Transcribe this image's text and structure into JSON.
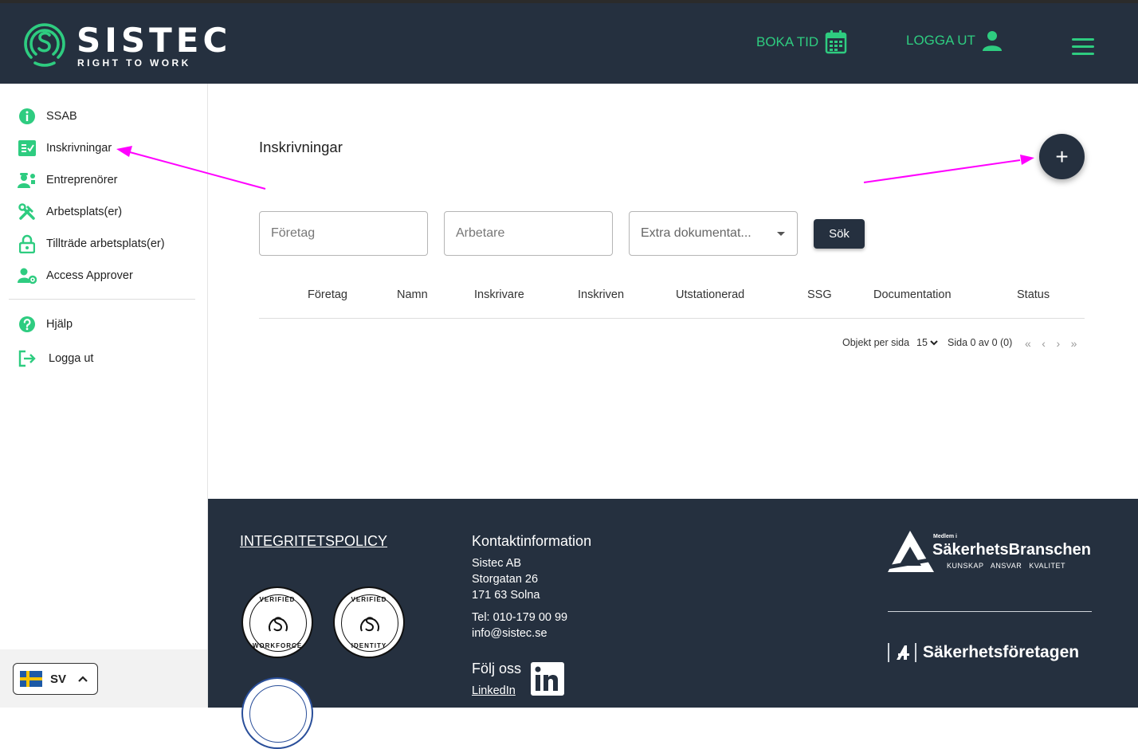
{
  "brand": {
    "name": "SISTEC",
    "tagline": "RIGHT TO WORK",
    "accent": "#2ecc80",
    "dark": "#25303f"
  },
  "header": {
    "book_label": "BOKA TID",
    "logout_label": "LOGGA UT",
    "icons": {
      "book": "calendar-icon",
      "logout": "user-icon",
      "menu": "hamburger-menu-icon"
    }
  },
  "sidebar": {
    "items": [
      {
        "label": "SSAB",
        "icon": "info-icon"
      },
      {
        "label": "Inskrivningar",
        "icon": "checklist-icon"
      },
      {
        "label": "Entreprenörer",
        "icon": "workers-icon"
      },
      {
        "label": "Arbetsplats(er)",
        "icon": "tools-icon"
      },
      {
        "label": "Tillträde arbetsplats(er)",
        "icon": "lock-icon"
      },
      {
        "label": "Access Approver",
        "icon": "user-gear-icon"
      }
    ],
    "secondary": [
      {
        "label": "Hjälp",
        "icon": "help-icon"
      },
      {
        "label": "Logga ut",
        "icon": "logout-icon"
      }
    ],
    "language": {
      "code": "SV",
      "flag": "sweden-flag-icon"
    }
  },
  "main": {
    "title": "Inskrivningar",
    "add_label": "+",
    "filters": {
      "company_placeholder": "Företag",
      "worker_placeholder": "Arbetare",
      "extra_docs": "Extra dokumentat...",
      "search_label": "Sök"
    },
    "columns": [
      "Företag",
      "Namn",
      "Inskrivare",
      "Inskriven",
      "Utstationerad",
      "SSG",
      "Documentation",
      "Status"
    ],
    "rows": [],
    "pagination": {
      "per_page_label": "Objekt per sida",
      "per_page_value": "15",
      "page_text": "Sida 0 av 0 (0)"
    }
  },
  "footer": {
    "privacy_label": "INTEGRITETSPOLICY",
    "contact_heading": "Kontaktinformation",
    "company": "Sistec AB",
    "street": "Storgatan 26",
    "city": "171 63 Solna",
    "phone": "Tel: 010-179 00 99",
    "email": "info@sistec.se",
    "follow_label": "Följ oss",
    "linkedin_label": "LinkedIn",
    "badges": [
      {
        "top": "VERIFIED",
        "bottom": "WORKFORCE"
      },
      {
        "top": "VERIFIED",
        "bottom": "IDENTITY"
      }
    ],
    "partner1": {
      "member": "Medlem i",
      "name": "SäkerhetsBranschen",
      "tags": "KUNSKAP ANSVAR KVALITET"
    },
    "partner2": {
      "name": "Säkerhetsföretagen"
    }
  }
}
